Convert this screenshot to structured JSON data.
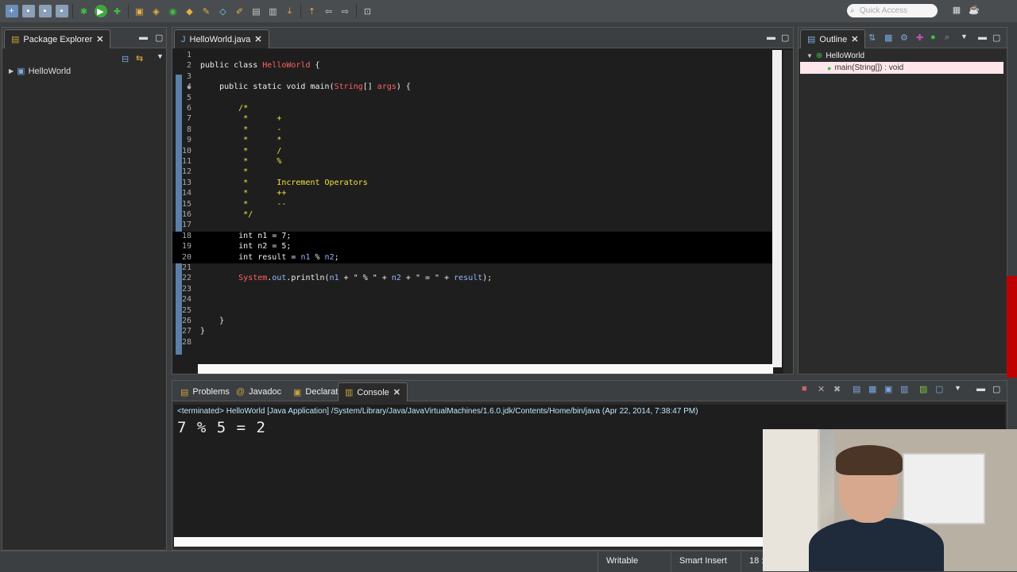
{
  "package_explorer": {
    "tab_label": "Package Explorer",
    "project": "HelloWorld"
  },
  "editor": {
    "tab_label": "HelloWorld.java",
    "lines": [
      {
        "n": "1",
        "segments": []
      },
      {
        "n": "2",
        "segments": [
          {
            "t": "public class ",
            "c": "kw"
          },
          {
            "t": "HelloWorld",
            "c": "cls"
          },
          {
            "t": " {",
            "c": "kw"
          }
        ]
      },
      {
        "n": "3",
        "segments": []
      },
      {
        "n": "4",
        "segments": [
          {
            "t": "    public static void ",
            "c": "kw"
          },
          {
            "t": "main",
            "c": "kw"
          },
          {
            "t": "(",
            "c": "kw"
          },
          {
            "t": "String",
            "c": "cls"
          },
          {
            "t": "[] ",
            "c": "kw"
          },
          {
            "t": "args",
            "c": "cls"
          },
          {
            "t": ") {",
            "c": "kw"
          }
        ]
      },
      {
        "n": "5",
        "segments": []
      },
      {
        "n": "6",
        "segments": [
          {
            "t": "        /*",
            "c": "cm"
          }
        ]
      },
      {
        "n": "7",
        "segments": [
          {
            "t": "         *      +",
            "c": "cm"
          }
        ]
      },
      {
        "n": "8",
        "segments": [
          {
            "t": "         *      -",
            "c": "cm"
          }
        ]
      },
      {
        "n": "9",
        "segments": [
          {
            "t": "         *      *",
            "c": "cm"
          }
        ]
      },
      {
        "n": "10",
        "segments": [
          {
            "t": "         *      /",
            "c": "cm"
          }
        ]
      },
      {
        "n": "11",
        "segments": [
          {
            "t": "         *      %",
            "c": "cm"
          }
        ]
      },
      {
        "n": "12",
        "segments": [
          {
            "t": "         *",
            "c": "cm"
          }
        ]
      },
      {
        "n": "13",
        "segments": [
          {
            "t": "         *      Increment Operators",
            "c": "cm"
          }
        ]
      },
      {
        "n": "14",
        "segments": [
          {
            "t": "         *      ++",
            "c": "cm"
          }
        ]
      },
      {
        "n": "15",
        "segments": [
          {
            "t": "         *      --",
            "c": "cm"
          }
        ]
      },
      {
        "n": "16",
        "segments": [
          {
            "t": "         */",
            "c": "cm"
          }
        ]
      },
      {
        "n": "17",
        "segments": []
      },
      {
        "n": "18",
        "segments": [
          {
            "t": "        int ",
            "c": "kw"
          },
          {
            "t": "n1",
            "c": "kw"
          },
          {
            "t": " = 7;",
            "c": "kw"
          }
        ]
      },
      {
        "n": "19",
        "segments": [
          {
            "t": "        int ",
            "c": "kw"
          },
          {
            "t": "n2",
            "c": "kw"
          },
          {
            "t": " = 5;",
            "c": "kw"
          }
        ]
      },
      {
        "n": "20",
        "segments": [
          {
            "t": "        int ",
            "c": "kw"
          },
          {
            "t": "result",
            "c": "kw"
          },
          {
            "t": " = ",
            "c": "kw"
          },
          {
            "t": "n1",
            "c": "fld"
          },
          {
            "t": " % ",
            "c": "kw"
          },
          {
            "t": "n2",
            "c": "fld"
          },
          {
            "t": ";",
            "c": "kw"
          }
        ]
      },
      {
        "n": "21",
        "segments": []
      },
      {
        "n": "22",
        "segments": [
          {
            "t": "        ",
            "c": "kw"
          },
          {
            "t": "System",
            "c": "cls"
          },
          {
            "t": ".",
            "c": "kw"
          },
          {
            "t": "out",
            "c": "fld"
          },
          {
            "t": ".println(",
            "c": "kw"
          },
          {
            "t": "n1",
            "c": "fld"
          },
          {
            "t": " + ",
            "c": "kw"
          },
          {
            "t": "\" % \"",
            "c": "str"
          },
          {
            "t": " + ",
            "c": "kw"
          },
          {
            "t": "n2",
            "c": "fld"
          },
          {
            "t": " + ",
            "c": "kw"
          },
          {
            "t": "\" = \"",
            "c": "str"
          },
          {
            "t": " + ",
            "c": "kw"
          },
          {
            "t": "result",
            "c": "fld"
          },
          {
            "t": ");",
            "c": "kw"
          }
        ]
      },
      {
        "n": "23",
        "segments": []
      },
      {
        "n": "24",
        "segments": []
      },
      {
        "n": "25",
        "segments": []
      },
      {
        "n": "26",
        "segments": [
          {
            "t": "    }",
            "c": "kw"
          }
        ]
      },
      {
        "n": "27",
        "segments": [
          {
            "t": "}",
            "c": "kw"
          }
        ]
      },
      {
        "n": "28",
        "segments": []
      }
    ],
    "highlight_lines": [
      "18",
      "19",
      "20"
    ]
  },
  "outline": {
    "tab_label": "Outline",
    "class_name": "HelloWorld",
    "method": "main(String[]) : void"
  },
  "bottom_tabs": [
    {
      "label": "Problems",
      "icon": "problems-icon"
    },
    {
      "label": "Javadoc",
      "icon": "javadoc-icon"
    },
    {
      "label": "Declaration",
      "icon": "declaration-icon"
    },
    {
      "label": "Console",
      "icon": "console-icon"
    }
  ],
  "console": {
    "header": "<terminated> HelloWorld [Java Application] /System/Library/Java/JavaVirtualMachines/1.6.0.jdk/Contents/Home/bin/java (Apr 22, 2014, 7:38:47 PM)",
    "output": "7 % 5 = 2"
  },
  "toolbar": {
    "quick_access_placeholder": "Quick Access"
  },
  "status": {
    "writable": "Writable",
    "insert_mode": "Smart Insert",
    "position": "18 :"
  },
  "colors": {
    "comment": "#f0e040",
    "type": "#ff6060",
    "field": "#9ab3ff",
    "background": "#1e1e1e"
  }
}
